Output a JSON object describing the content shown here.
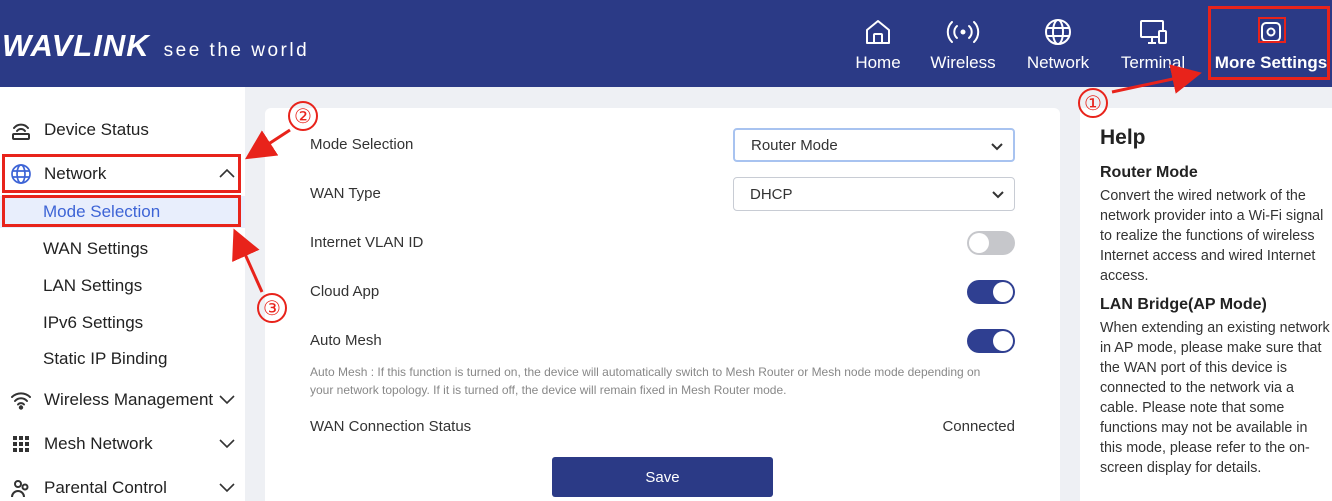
{
  "brand": {
    "name": "WAVLINK",
    "tagline": "see the world"
  },
  "nav": [
    {
      "label": "Home",
      "icon": "home-icon"
    },
    {
      "label": "Wireless",
      "icon": "wireless-signal-icon"
    },
    {
      "label": "Network",
      "icon": "globe-icon"
    },
    {
      "label": "Terminal",
      "icon": "monitor-icon"
    },
    {
      "label": "More Settings",
      "icon": "gear-icon"
    }
  ],
  "sidebar": {
    "items": [
      {
        "label": "Device Status",
        "icon": "router-icon"
      },
      {
        "label": "Network",
        "icon": "globe-icon",
        "expanded": true
      },
      {
        "label": "Wireless Management",
        "icon": "wifi-icon"
      },
      {
        "label": "Mesh Network",
        "icon": "grid-icon"
      },
      {
        "label": "Parental Control",
        "icon": "parental-icon"
      }
    ],
    "network_sub": [
      "Mode Selection",
      "WAN Settings",
      "LAN Settings",
      "IPv6 Settings",
      "Static IP Binding"
    ],
    "active_sub": "Mode Selection"
  },
  "form": {
    "mode_selection": {
      "label": "Mode Selection",
      "value": "Router Mode"
    },
    "wan_type": {
      "label": "WAN Type",
      "value": "DHCP"
    },
    "internet_vlan": {
      "label": "Internet VLAN ID",
      "enabled": false
    },
    "cloud_app": {
      "label": "Cloud App",
      "enabled": true
    },
    "auto_mesh": {
      "label": "Auto Mesh",
      "enabled": true
    },
    "auto_mesh_note": "Auto Mesh : If this function is turned on, the device will automatically switch to Mesh Router or Mesh node mode depending on your network topology. If it is turned off, the device will remain fixed in Mesh Router mode.",
    "wan_status": {
      "label": "WAN Connection Status",
      "value": "Connected"
    },
    "save_label": "Save"
  },
  "help": {
    "title": "Help",
    "sections": [
      {
        "heading": "Router Mode",
        "text": "Convert the wired network of the network provider into a Wi-Fi signal to realize the functions of wireless Internet access and wired Internet access."
      },
      {
        "heading": "LAN Bridge(AP Mode)",
        "text": "When extending an existing network in AP mode, please make sure that the WAN port of this device is connected to the network via a cable. Please note that some functions may not be available in this mode, please refer to the on-screen display for details."
      }
    ]
  },
  "annotations": [
    "①",
    "②",
    "③"
  ],
  "colors": {
    "header": "#2b3a86",
    "accent": "#3d64d6",
    "callout": "#e8231b",
    "toggle_on": "#2f3f91"
  }
}
